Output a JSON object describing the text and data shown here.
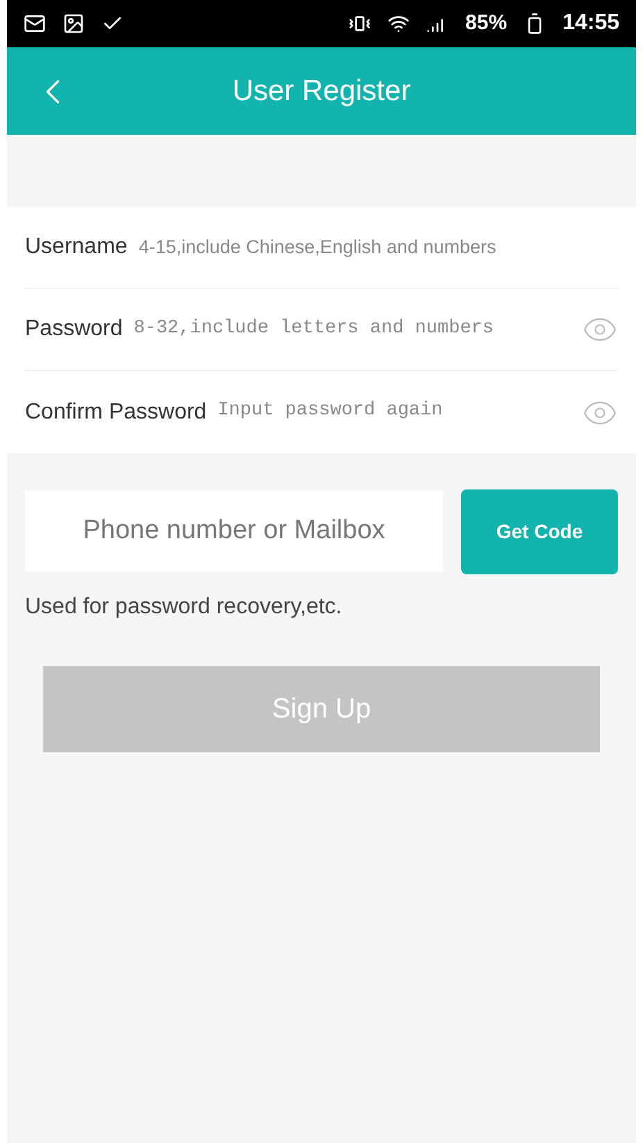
{
  "status_bar": {
    "battery": "85%",
    "time": "14:55"
  },
  "header": {
    "title": "User Register"
  },
  "fields": [
    {
      "kind": "text",
      "label": "Username",
      "placeholder": "4-15,include Chinese,English and numbers"
    },
    {
      "kind": "password",
      "label": "Password",
      "placeholder": "8-32,include letters and numbers"
    },
    {
      "kind": "password",
      "label": "Confirm Password",
      "placeholder": "Input password again"
    }
  ],
  "contact": {
    "placeholder": "Phone number or Mailbox",
    "button": "Get Code",
    "hint": "Used for password recovery,etc."
  },
  "sign_up": {
    "label": "Sign Up",
    "disabled": true
  }
}
